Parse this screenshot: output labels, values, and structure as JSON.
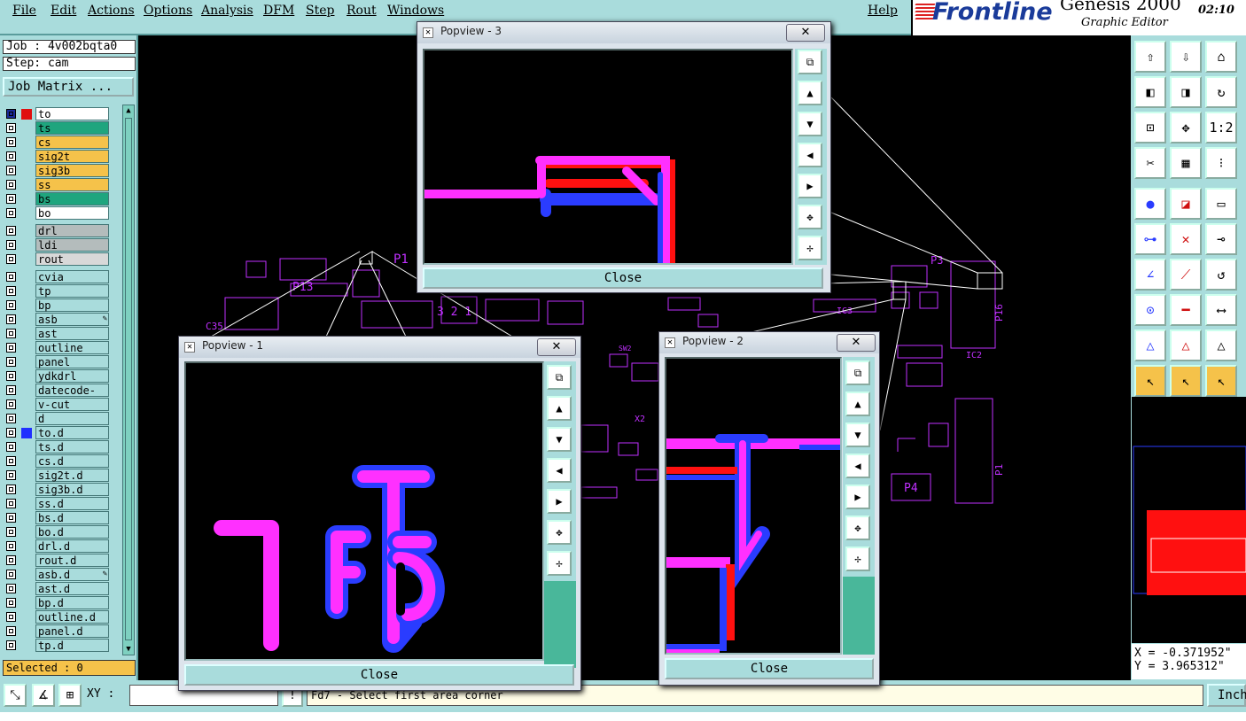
{
  "menu": {
    "items": [
      "File",
      "Edit",
      "Actions",
      "Options",
      "Analysis",
      "DFM",
      "Step",
      "Rout",
      "Windows"
    ],
    "help": "Help"
  },
  "brand": {
    "logo": "Frontline",
    "product": "Genesis 2000",
    "subtitle": "Graphic Editor",
    "time": "02:10"
  },
  "job": {
    "job_label": "Job : 4v002bqta0",
    "step_label": "Step: cam",
    "matrix_button": "Job Matrix ..."
  },
  "layers": [
    {
      "name": "to",
      "color": "#ffffff",
      "swatch": "#e01010",
      "active": true
    },
    {
      "name": "ts",
      "color": "#1fa57e"
    },
    {
      "name": "cs",
      "color": "#f5c24a"
    },
    {
      "name": "sig2t",
      "color": "#f5c24a"
    },
    {
      "name": "sig3b",
      "color": "#f5c24a"
    },
    {
      "name": "ss",
      "color": "#f5c24a"
    },
    {
      "name": "bs",
      "color": "#1fa57e"
    },
    {
      "name": "bo",
      "color": "#ffffff"
    },
    {
      "name": "drl",
      "color": "#b4bcbc",
      "gap": true
    },
    {
      "name": "ldi",
      "color": "#b4bcbc"
    },
    {
      "name": "rout",
      "color": "#d8d8d8"
    },
    {
      "name": "cvia",
      "color": "#a9dcdc",
      "gap": true
    },
    {
      "name": "tp",
      "color": "#a9dcdc"
    },
    {
      "name": "bp",
      "color": "#a9dcdc"
    },
    {
      "name": "asb",
      "color": "#a9dcdc",
      "mark": "✎"
    },
    {
      "name": "ast",
      "color": "#a9dcdc"
    },
    {
      "name": "outline",
      "color": "#a9dcdc"
    },
    {
      "name": "panel",
      "color": "#a9dcdc"
    },
    {
      "name": "ydkdrl",
      "color": "#a9dcdc"
    },
    {
      "name": "datecode-bs",
      "color": "#a9dcdc"
    },
    {
      "name": "v-cut",
      "color": "#a9dcdc"
    },
    {
      "name": "d",
      "color": "#a9dcdc"
    },
    {
      "name": "to.d",
      "color": "#a9dcdc",
      "swatch": "#2030ff"
    },
    {
      "name": "ts.d",
      "color": "#a9dcdc"
    },
    {
      "name": "cs.d",
      "color": "#a9dcdc"
    },
    {
      "name": "sig2t.d",
      "color": "#a9dcdc"
    },
    {
      "name": "sig3b.d",
      "color": "#a9dcdc"
    },
    {
      "name": "ss.d",
      "color": "#a9dcdc"
    },
    {
      "name": "bs.d",
      "color": "#a9dcdc"
    },
    {
      "name": "bo.d",
      "color": "#a9dcdc"
    },
    {
      "name": "drl.d",
      "color": "#a9dcdc"
    },
    {
      "name": "rout.d",
      "color": "#a9dcdc"
    },
    {
      "name": "asb.d",
      "color": "#a9dcdc",
      "mark": "✎"
    },
    {
      "name": "ast.d",
      "color": "#a9dcdc"
    },
    {
      "name": "bp.d",
      "color": "#a9dcdc"
    },
    {
      "name": "outline.d",
      "color": "#a9dcdc"
    },
    {
      "name": "panel.d",
      "color": "#a9dcdc"
    },
    {
      "name": "tp.d",
      "color": "#a9dcdc"
    }
  ],
  "selected": "Selected : 0",
  "canvas_labels": {
    "p1": "P1",
    "p3": "P3",
    "p4": "P4",
    "p16": "P16",
    "p13": "P13",
    "ic2": "IC2",
    "ic3": "IC3",
    "c35": "C35",
    "x2": "X2",
    "sw2": "SW2",
    "n321": "3 2 1"
  },
  "popviews": [
    {
      "title": "Popview - 3",
      "close": "Close"
    },
    {
      "title": "Popview - 1",
      "close": "Close"
    },
    {
      "title": "Popview - 2",
      "close": "Close"
    }
  ],
  "toolbar_icons": [
    "move-up-icon",
    "move-down-icon",
    "home-icon",
    "pan-left-icon",
    "pan-right-icon",
    "rotate-icon",
    "fit-icon",
    "center-icon",
    "ratio-icon",
    "measure-icon",
    "grid-icon",
    "snap-icon",
    "pad-icon",
    "cross-line-icon",
    "ruler-icon",
    "net-icon",
    "x-icon",
    "connect-icon",
    "angle-icon",
    "slash-icon",
    "arc-icon",
    "pad-dot-icon",
    "line-icon",
    "dimension-icon",
    "triangle-icon",
    "triangle-a-icon",
    "triangle-b-icon",
    "pointer-icon",
    "pointer-2-icon",
    "pointer-3-icon"
  ],
  "toolbar_labels": {
    "ratio": "1:2"
  },
  "coords": {
    "x": "X = -0.371952\"",
    "y": "Y = 3.965312\""
  },
  "bottom": {
    "xy_label": "XY :",
    "xy_value": "",
    "message": "Fd7 - Select first area corner",
    "units": "Inch"
  },
  "colors": {
    "accent": "#a9dcdc",
    "highlight": "#f5c24a",
    "magenta": "#ff30ff",
    "blue": "#2a3cff",
    "red": "#ff1010"
  }
}
